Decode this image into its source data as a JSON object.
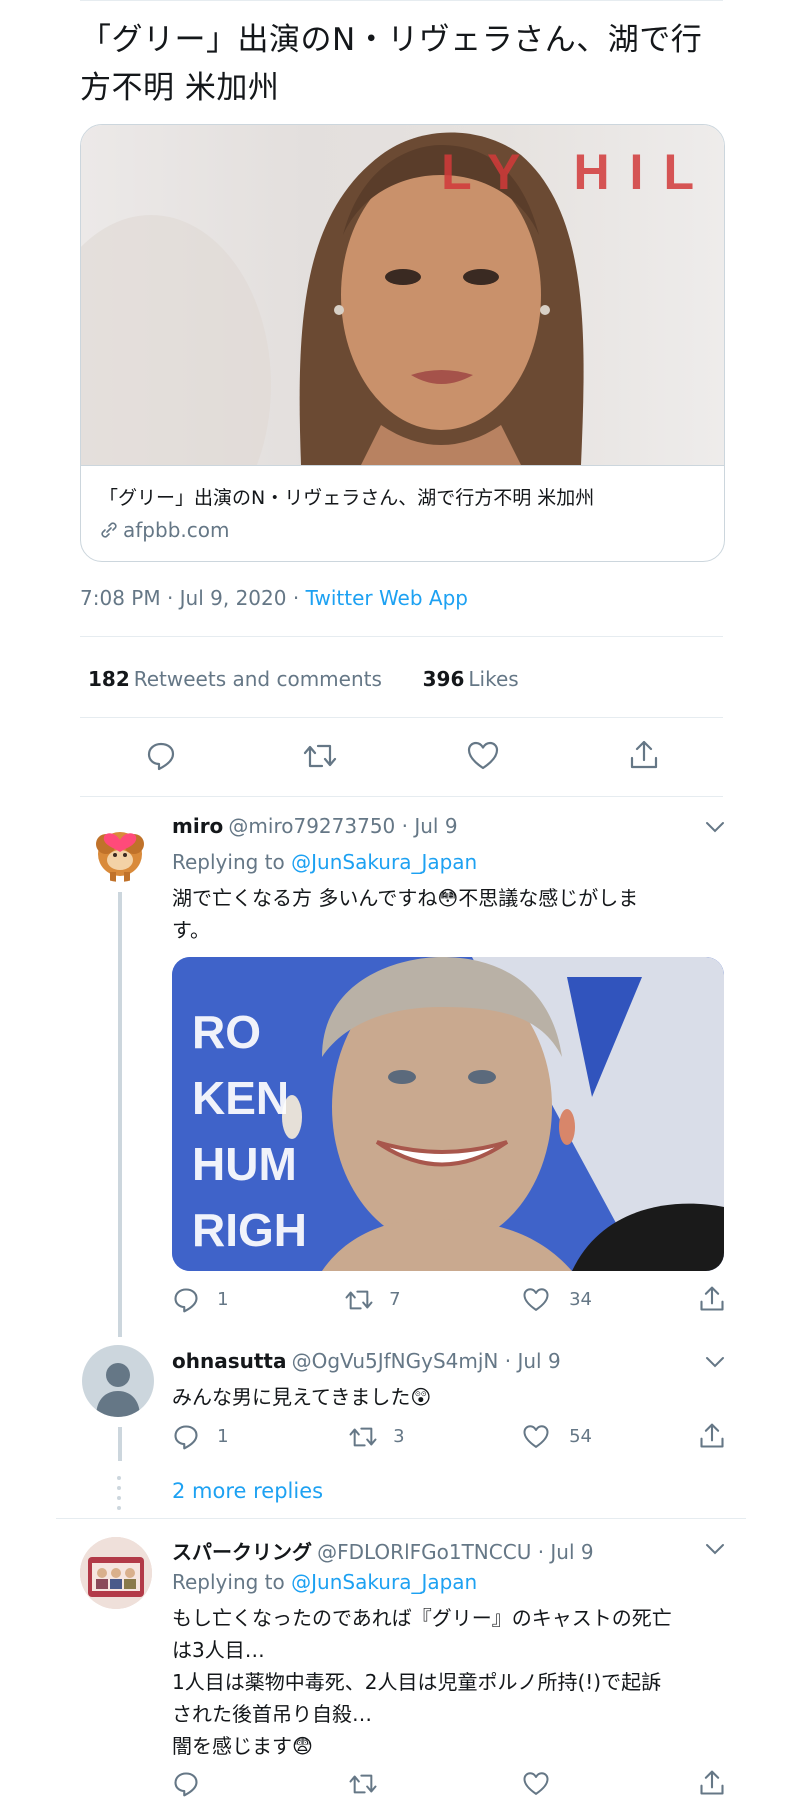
{
  "tweet": {
    "title": "「グリー」出演のN・リヴェラさん、湖で行方不明 米加州",
    "card": {
      "image_text": "LY HIL",
      "text": "「グリー」出演のN・リヴェラさん、湖で行方不明 米加州",
      "domain": "afpbb.com"
    },
    "time": "7:08 PM · Jul 9, 2020 · ",
    "source": "Twitter Web App",
    "retweets_count": "182",
    "retweets_label": "Retweets and comments",
    "likes_count": "396",
    "likes_label": "Likes"
  },
  "replies": [
    {
      "name": "miro",
      "handle": "@miro79273750 · Jul 9",
      "replying_prefix": "Replying to ",
      "replying_to": "@JunSakura_Japan",
      "text_line1": "湖で亡くなる方 多いんですね😳不思議な感じがしま",
      "text_line2": "す。",
      "image_text": [
        "RO",
        "KEN",
        "HUM",
        "RIGH"
      ],
      "reply_count": "1",
      "retweet_count": "7",
      "like_count": "34"
    },
    {
      "name": "ohnasutta",
      "handle": "@OgVu5JfNGyS4mjN · Jul 9",
      "text": "みんな男に見えてきました😲",
      "reply_count": "1",
      "retweet_count": "3",
      "like_count": "54"
    },
    {
      "name": "スパークリング",
      "handle": "@FDLORlFGo1TNCCU · Jul 9",
      "replying_prefix": "Replying to ",
      "replying_to": "@JunSakura_Japan",
      "text_lines": [
        "もし亡くなったのであれば『グリー』のキャストの死亡",
        "は3人目…",
        "1人目は薬物中毒死、2人目は児童ポルノ所持(!)で起訴",
        "された後首吊り自殺…",
        "闇を感じます😨"
      ]
    }
  ],
  "more_replies": "2 more replies",
  "colors": {
    "accent": "#1da1f2",
    "muted": "#657786",
    "border": "#ccd6dd"
  },
  "icons": [
    "reply-icon",
    "retweet-icon",
    "like-icon",
    "share-icon",
    "link-icon",
    "chevron-down-icon"
  ]
}
